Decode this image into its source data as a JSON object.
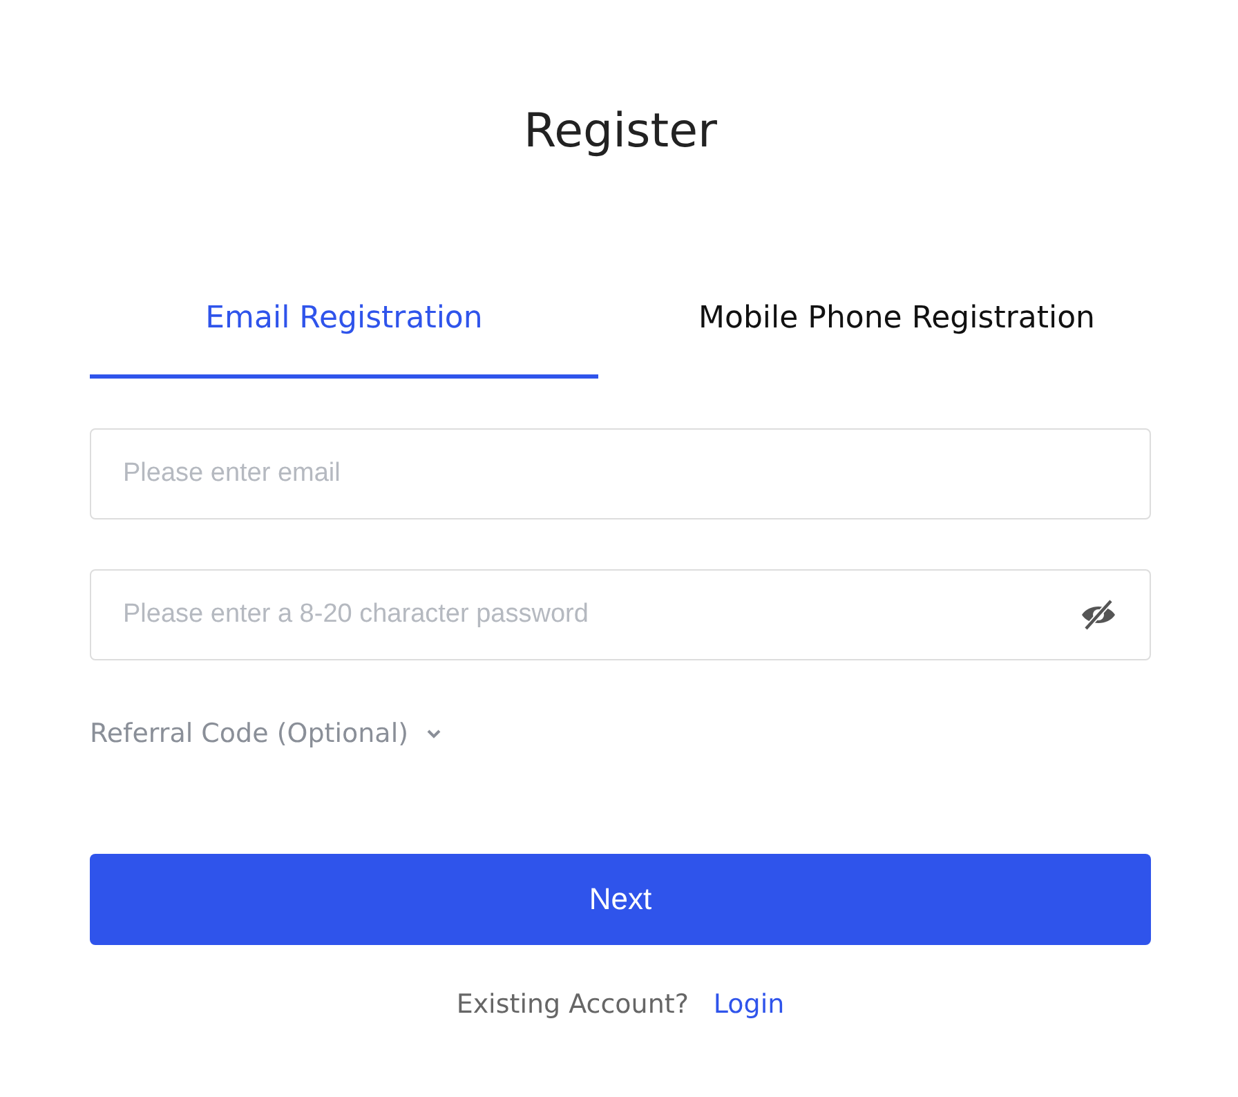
{
  "title": "Register",
  "tabs": [
    {
      "label": "Email Registration",
      "selected": true
    },
    {
      "label": "Mobile Phone Registration",
      "selected": false
    }
  ],
  "fields": [
    {
      "kind": "text",
      "placeholder": "Please enter email"
    },
    {
      "kind": "password",
      "placeholder": "Please enter a 8-20 character password",
      "visible": false
    }
  ],
  "referral": {
    "label": "Referral Code (Optional)",
    "expanded": false
  },
  "next_button": "Next",
  "footer": {
    "text": "Existing Account?",
    "link": "Login"
  }
}
